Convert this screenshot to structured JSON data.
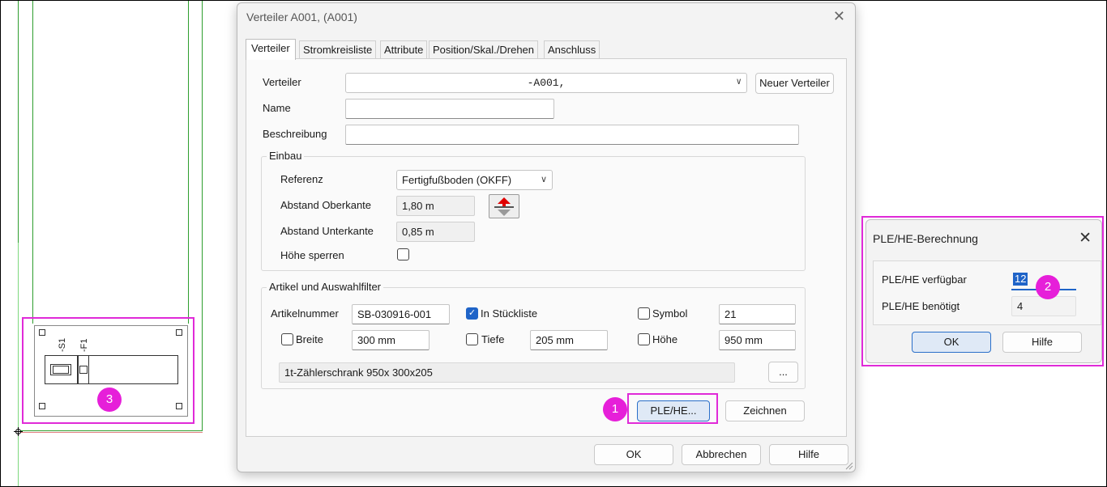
{
  "dialog": {
    "title": "Verteiler A001,  (A001)",
    "tabs": [
      "Verteiler",
      "Stromkreisliste",
      "Attribute",
      "Position/Skal./Drehen",
      "Anschluss"
    ],
    "verteiler_label": "Verteiler",
    "verteiler_value": "-A001,",
    "neuer_verteiler_button": "Neuer Verteiler",
    "name_label": "Name",
    "name_value": "",
    "beschreibung_label": "Beschreibung",
    "beschreibung_value": "",
    "einbau": {
      "title": "Einbau",
      "referenz_label": "Referenz",
      "referenz_value": "Fertigfußboden (OKFF)",
      "oberkante_label": "Abstand Oberkante",
      "oberkante_value": "1,80 m",
      "unterkante_label": "Abstand Unterkante",
      "unterkante_value": "0,85 m",
      "hoehe_sperren_label": "Höhe sperren",
      "hoehe_sperren_checked": false
    },
    "artikel": {
      "title": "Artikel und Auswahlfilter",
      "artikelnummer_label": "Artikelnummer",
      "artikelnummer_value": "SB-030916-001",
      "in_stueckliste_label": "In Stückliste",
      "in_stueckliste_checked": true,
      "symbol_label": "Symbol",
      "symbol_value": "21",
      "breite_label": "Breite",
      "breite_value": "300 mm",
      "tiefe_label": "Tiefe",
      "tiefe_value": "205 mm",
      "hoehe_label": "Höhe",
      "hoehe_value": "950 mm",
      "description": "1t-Zählerschrank  950x 300x205",
      "browse_button": "..."
    },
    "ple_he_button": "PLE/HE...",
    "zeichnen_button": "Zeichnen",
    "ok_button": "OK",
    "abbrechen_button": "Abbrechen",
    "hilfe_button": "Hilfe"
  },
  "ple_dialog": {
    "title": "PLE/HE-Berechnung",
    "verfuegbar_label": "PLE/HE verfügbar",
    "verfuegbar_value": "12",
    "benoetigt_label": "PLE/HE benötigt",
    "benoetigt_value": "4",
    "ok_button": "OK",
    "hilfe_button": "Hilfe"
  },
  "cad": {
    "label_s1": "-S1",
    "label_f1": "-F1"
  },
  "badges": [
    "1",
    "2",
    "3"
  ],
  "colors": {
    "highlight": "#e02ad8",
    "badge": "#e61fd9",
    "cad_line": "#2e9e2e",
    "accent": "#1f64c8"
  }
}
